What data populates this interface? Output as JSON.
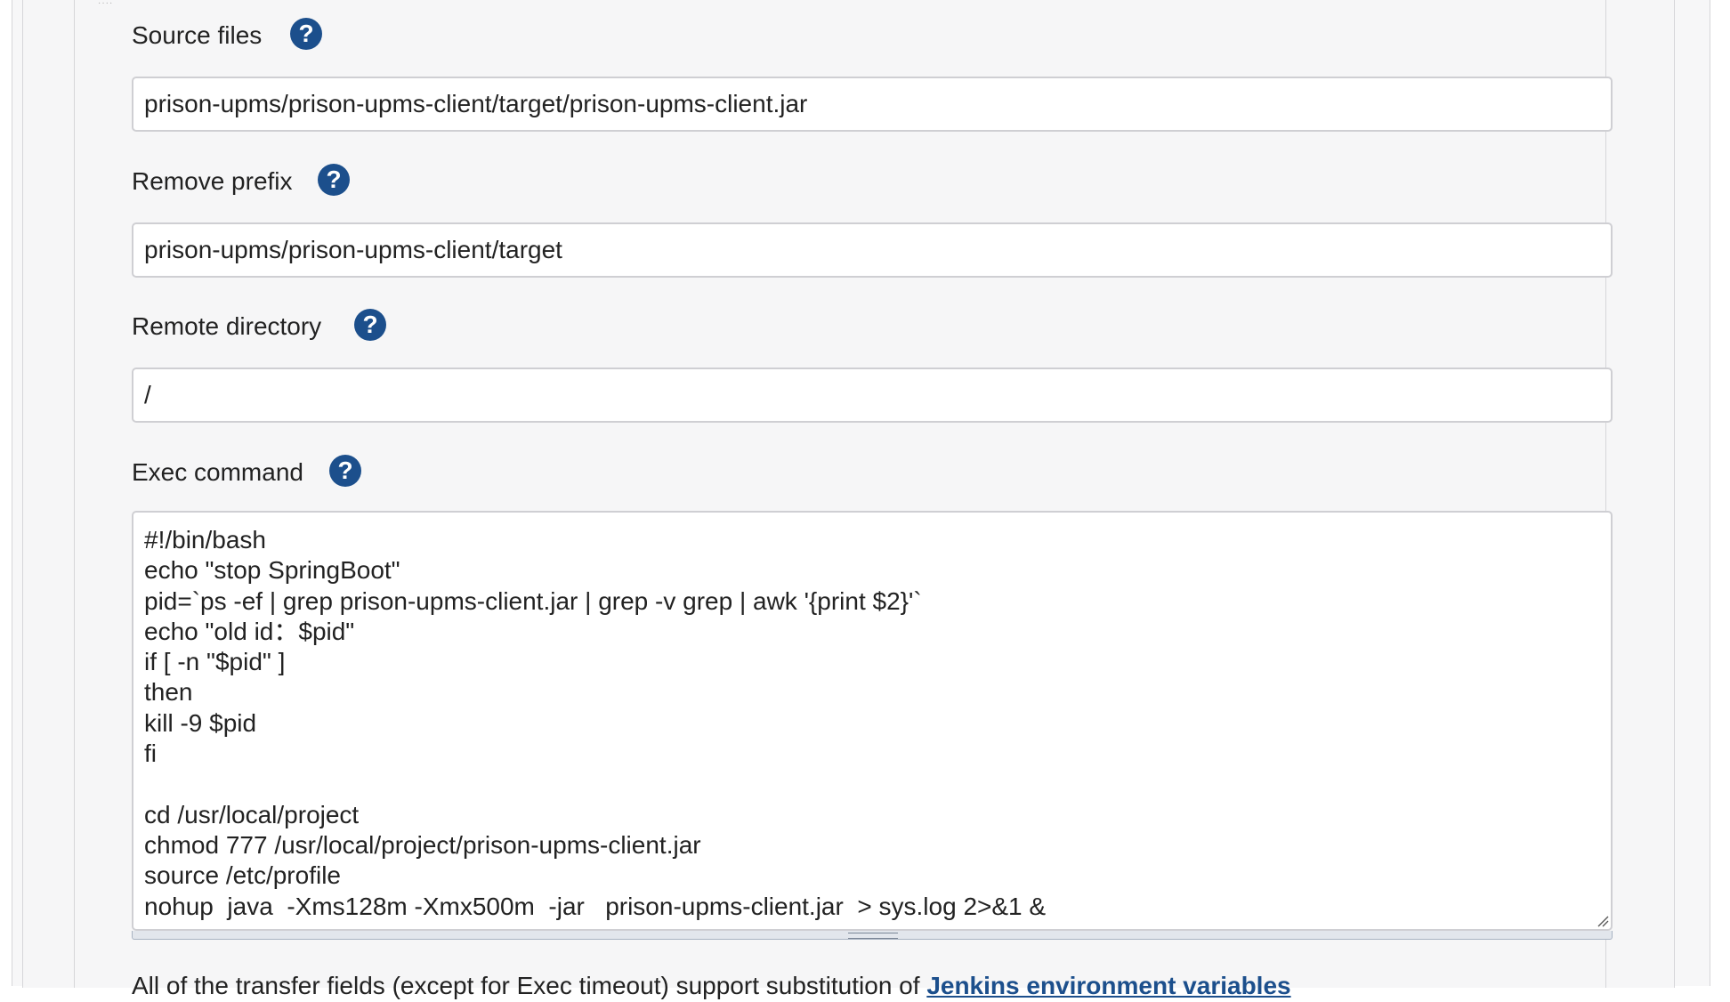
{
  "fields": {
    "source_files": {
      "label": "Source files",
      "value": "prison-upms/prison-upms-client/target/prison-upms-client.jar"
    },
    "remove_prefix": {
      "label": "Remove prefix",
      "value": "prison-upms/prison-upms-client/target"
    },
    "remote_directory": {
      "label": "Remote directory",
      "value": "/"
    },
    "exec_command": {
      "label": "Exec command",
      "value": "#!/bin/bash\necho \"stop SpringBoot\"\npid=`ps -ef | grep prison-upms-client.jar | grep -v grep | awk '{print $2}'`\necho \"old id：$pid\"\nif [ -n \"$pid\" ]\nthen\nkill -9 $pid\nfi\n\ncd /usr/local/project\nchmod 777 /usr/local/project/prison-upms-client.jar\nsource /etc/profile\nnohup  java  -Xms128m -Xmx500m  -jar   prison-upms-client.jar  > sys.log 2>&1 &"
    }
  },
  "help_icon_glyph": "?",
  "footer": {
    "text": "All of the transfer fields (except for Exec timeout) support substitution of ",
    "link": "Jenkins environment variables"
  },
  "colors": {
    "help_icon": "#1c4f8c",
    "link": "#1c4f8c",
    "input_border": "#cfcfd3",
    "panel_background": "#f6f6f7"
  }
}
